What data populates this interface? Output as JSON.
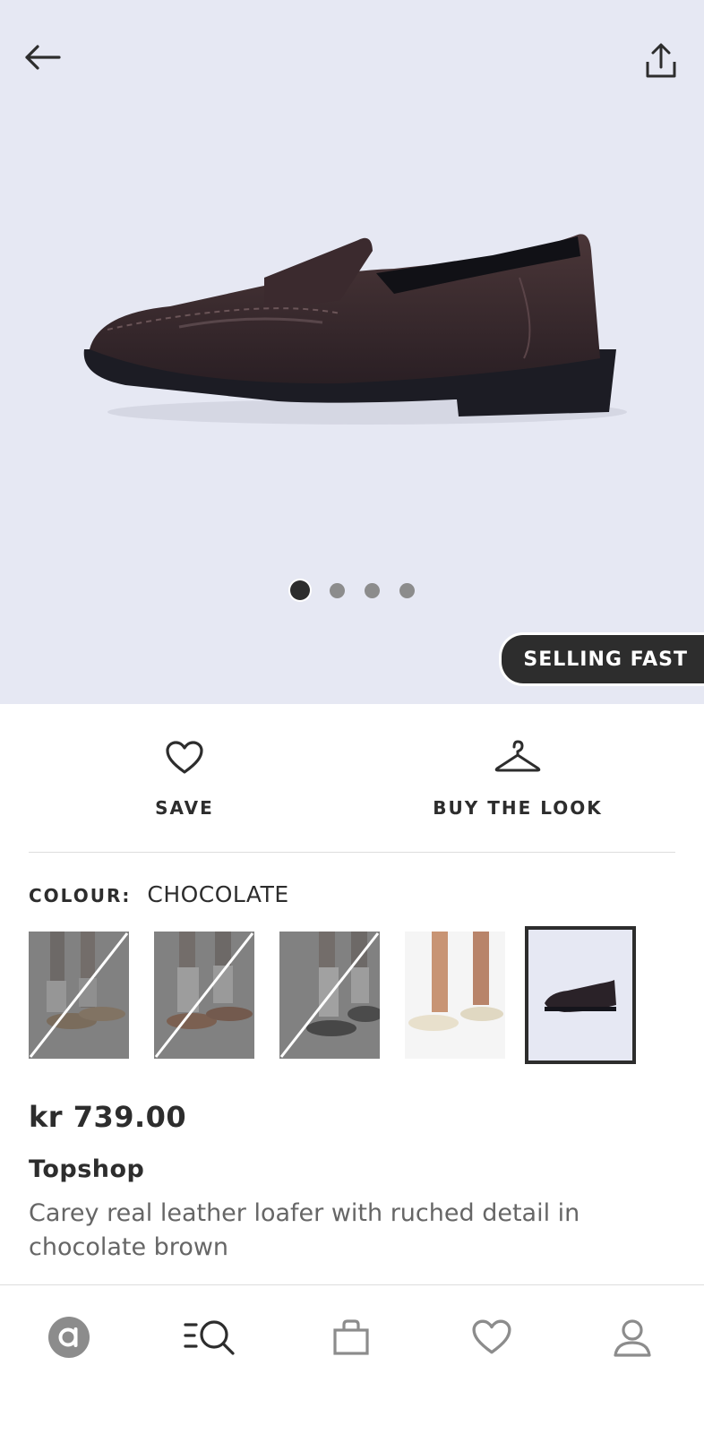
{
  "header": {
    "back_icon": "arrow-left-icon",
    "share_icon": "share-icon"
  },
  "gallery": {
    "image_count": 4,
    "active_index": 0,
    "badge": "SELLING FAST",
    "background": "#e6e8f3"
  },
  "actions": {
    "save_label": "SAVE",
    "save_icon": "heart-icon",
    "look_label": "BUY THE LOOK",
    "look_icon": "hanger-icon"
  },
  "colour": {
    "label": "COLOUR:",
    "value": "CHOCOLATE",
    "swatches": [
      {
        "variant": "leopard",
        "available": false
      },
      {
        "variant": "tan",
        "available": false
      },
      {
        "variant": "black",
        "available": false
      },
      {
        "variant": "cream",
        "available": true
      },
      {
        "variant": "chocolate",
        "available": true,
        "selected": true
      }
    ]
  },
  "product": {
    "price": "kr 739.00",
    "brand": "Topshop",
    "description": "Carey real leather loafer with ruched detail in chocolate brown"
  },
  "bottom_nav": {
    "items": [
      "home-logo-icon",
      "search-icon",
      "bag-icon",
      "saved-heart-icon",
      "account-icon"
    ]
  },
  "colors": {
    "text": "#2d2d2d",
    "muted": "#666666",
    "hero_bg": "#e6e8f3",
    "badge_bg": "#2d2d2d"
  }
}
